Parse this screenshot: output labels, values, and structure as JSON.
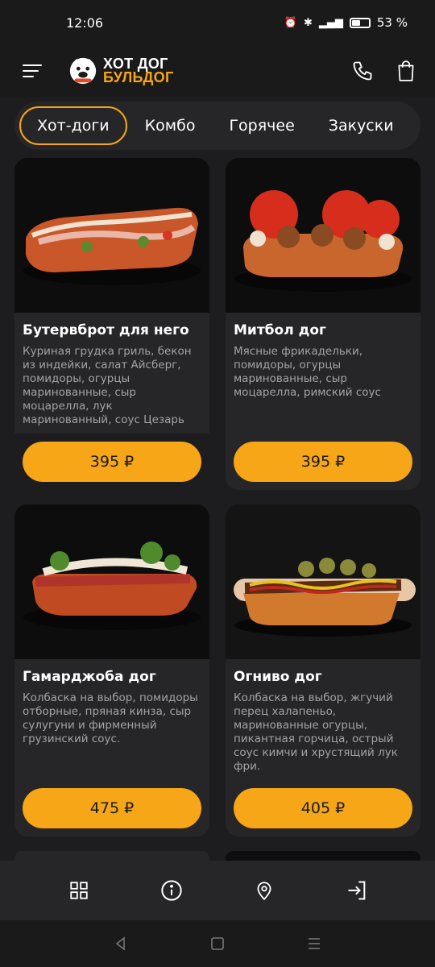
{
  "status": {
    "time": "12:06",
    "battery": "53 %"
  },
  "brand": {
    "line1": "ХОТ ДОГ",
    "line2": "БУЛЬДОГ"
  },
  "tabs": [
    {
      "label": "Хот-доги",
      "active": true
    },
    {
      "label": "Комбо"
    },
    {
      "label": "Горячее"
    },
    {
      "label": "Закуски"
    }
  ],
  "products": [
    {
      "title": "Бутервброт для него",
      "description": "Куриная грудка гриль, бекон из индейки, салат Айсберг, помидоры, огурцы маринованные, сыр моцарелла, лук маринованный, соус Цезарь",
      "price": "395 ₽"
    },
    {
      "title": "Митбол дог",
      "description": "Мясные фрикадельки, помидоры, огурцы маринованные, сыр моцарелла, римский соус",
      "price": "395 ₽"
    },
    {
      "title": "Гамарджоба дог",
      "description": "Колбаска на выбор, помидоры отборные, пряная кинза, сыр сулугуни и фирменный грузинский соус.",
      "price": "475 ₽"
    },
    {
      "title": "Огниво дог",
      "description": "Колбаска на выбор, жгучий перец халапеньо, маринованные огурцы, пикантная горчица, острый соус кимчи и хрустящий лук фри.",
      "price": "405 ₽"
    }
  ],
  "colors": {
    "accent": "#f6a616",
    "background": "#1d1d1f",
    "card": "#262628"
  }
}
